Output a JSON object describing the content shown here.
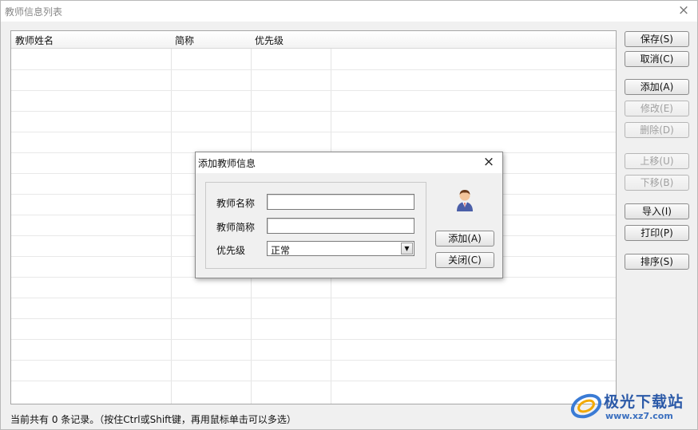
{
  "window": {
    "title": "教师信息列表",
    "close": "×"
  },
  "table": {
    "columns": [
      "教师姓名",
      "简称",
      "优先级"
    ]
  },
  "buttons": {
    "save": "保存(S)",
    "cancel": "取消(C)",
    "add": "添加(A)",
    "edit": "修改(E)",
    "delete": "删除(D)",
    "move_up": "上移(U)",
    "move_down": "下移(B)",
    "import": "导入(I)",
    "print": "打印(P)",
    "sort": "排序(S)"
  },
  "status": "当前共有 0 条记录。（按住Ctrl或Shift键，再用鼠标单击可以多选）",
  "dialog": {
    "title": "添加教师信息",
    "close": "×",
    "name_label": "教师名称",
    "name_value": "",
    "short_label": "教师简称",
    "short_value": "",
    "priority_label": "优先级",
    "priority_value": "正常",
    "add_button": "添加(A)",
    "close_button": "关闭(C)"
  },
  "watermark": {
    "name": "极光下载站",
    "url": "www.xz7.com"
  },
  "colors": {
    "watermark": "#2c5aa8",
    "disabled_text": "#a0a0a0"
  }
}
